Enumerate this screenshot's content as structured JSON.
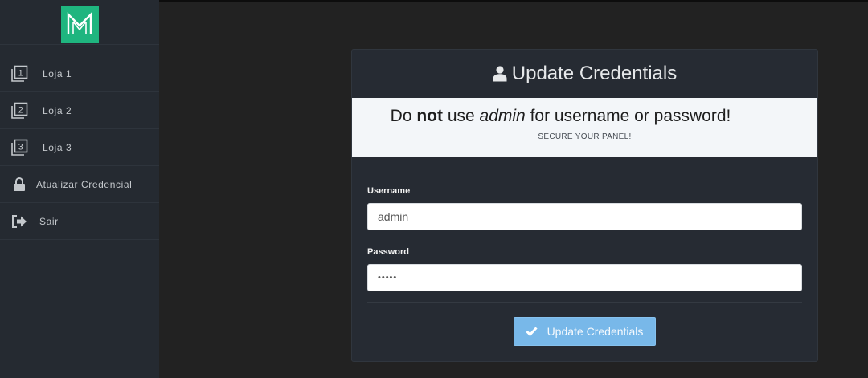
{
  "sidebar": {
    "logo_letter": "M",
    "items": [
      {
        "icon": "store-1-icon",
        "label": "Loja 1"
      },
      {
        "icon": "store-2-icon",
        "label": "Loja 2"
      },
      {
        "icon": "store-3-icon",
        "label": "Loja 3"
      },
      {
        "icon": "lock-icon",
        "label": "Atualizar Credencial"
      },
      {
        "icon": "sign-out-icon",
        "label": "Sair"
      }
    ]
  },
  "panel": {
    "title": "Update Credentials",
    "warning": {
      "prefix": "Do ",
      "bold": "not",
      "middle": " use ",
      "italic": "admin",
      "suffix": " for username or password!",
      "sub": "SECURE YOUR PANEL!"
    },
    "username": {
      "label": "Username",
      "value": "admin"
    },
    "password": {
      "label": "Password",
      "value": "•••••"
    },
    "submit_label": "Update Credentials"
  },
  "colors": {
    "background": "#222222",
    "sidebar": "#252a31",
    "logo": "#1fb57f",
    "panel": "#262b33",
    "button": "#78b8e9"
  }
}
